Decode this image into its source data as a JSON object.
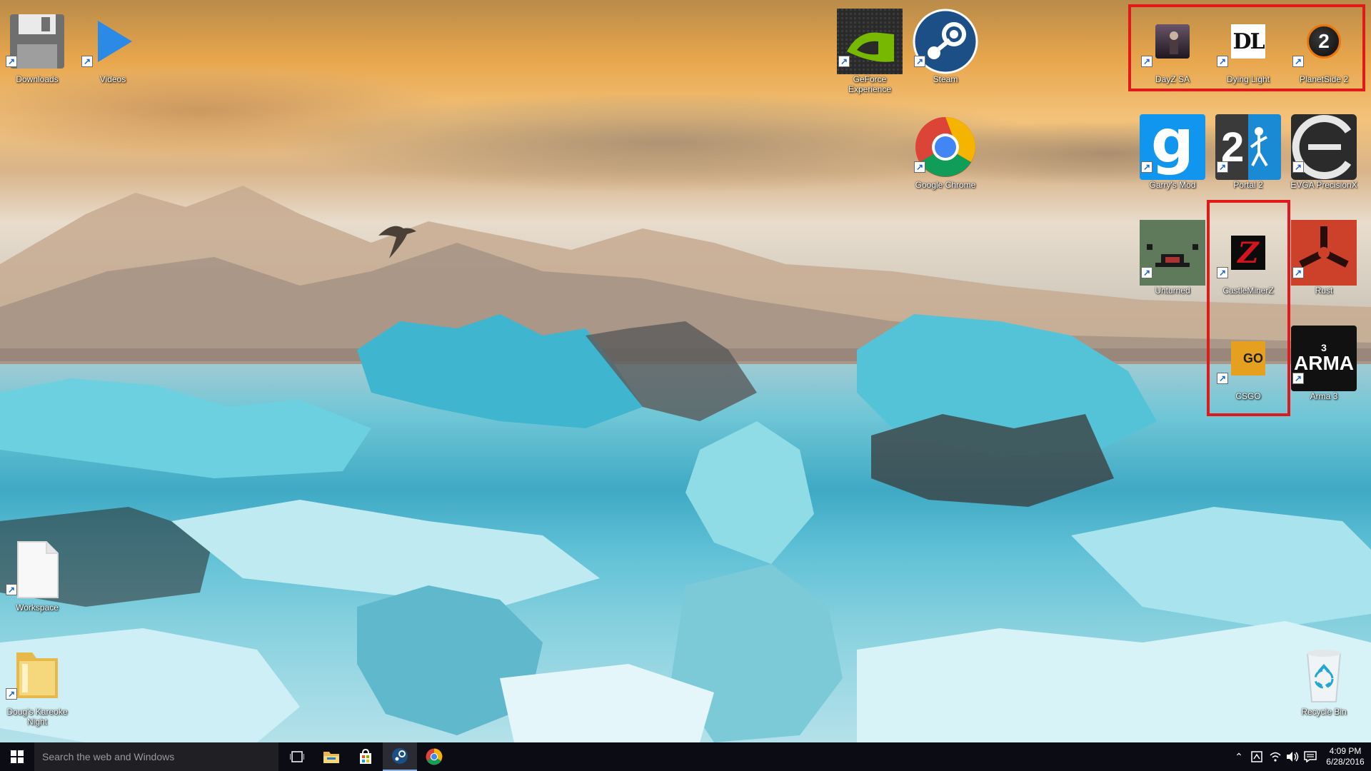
{
  "desktop": {
    "icons": [
      {
        "id": "downloads",
        "label": "Downloads",
        "icon": "floppy-disk-icon"
      },
      {
        "id": "videos",
        "label": "Videos",
        "icon": "play-triangle-icon"
      },
      {
        "id": "geforce",
        "label": "GeForce Experience",
        "icon": "nvidia-icon"
      },
      {
        "id": "steam",
        "label": "Steam",
        "icon": "steam-icon"
      },
      {
        "id": "dayz",
        "label": "DayZ SA",
        "icon": "dayz-icon"
      },
      {
        "id": "dyinglight",
        "label": "Dying Light",
        "icon": "dying-light-icon"
      },
      {
        "id": "planetside",
        "label": "PlanetSide 2",
        "icon": "planetside-icon"
      },
      {
        "id": "chrome",
        "label": "Google Chrome",
        "icon": "chrome-icon"
      },
      {
        "id": "garrysmod",
        "label": "Garry's Mod",
        "icon": "garrys-mod-icon"
      },
      {
        "id": "portal2",
        "label": "Portal 2",
        "icon": "portal-2-icon"
      },
      {
        "id": "evga",
        "label": "EVGA PrecisionX",
        "icon": "evga-icon"
      },
      {
        "id": "unturned",
        "label": "Unturned",
        "icon": "unturned-icon"
      },
      {
        "id": "castleminerz",
        "label": "CastleMinerZ",
        "icon": "castleminerz-icon"
      },
      {
        "id": "rust",
        "label": "Rust",
        "icon": "rust-icon"
      },
      {
        "id": "csgo",
        "label": "CSGO",
        "icon": "csgo-icon"
      },
      {
        "id": "arma3",
        "label": "Arma 3",
        "icon": "arma-icon"
      },
      {
        "id": "workspace",
        "label": "Workspace",
        "icon": "document-icon"
      },
      {
        "id": "karaoke",
        "label": "Doug's Kareoke Night",
        "icon": "folder-icon"
      },
      {
        "id": "recyclebin",
        "label": "Recycle Bin",
        "icon": "recycle-bin-icon"
      }
    ],
    "small_icon_text": {
      "dying_light": "DL",
      "portal_num": "2",
      "garrys_g": "g",
      "csgo": "GO",
      "arma": "ARMA",
      "arma_num": "3",
      "castle_z": "Z",
      "planetside_num": "2"
    }
  },
  "taskbar": {
    "search_placeholder": "Search the web and Windows",
    "time": "4:09 PM",
    "date": "6/28/2016",
    "pinned": [
      "task-view-icon",
      "file-explorer-icon",
      "store-icon",
      "steam-icon",
      "chrome-icon"
    ]
  },
  "colors": {
    "highlight": "#e01a1a",
    "taskbar": "#0c0c14"
  }
}
